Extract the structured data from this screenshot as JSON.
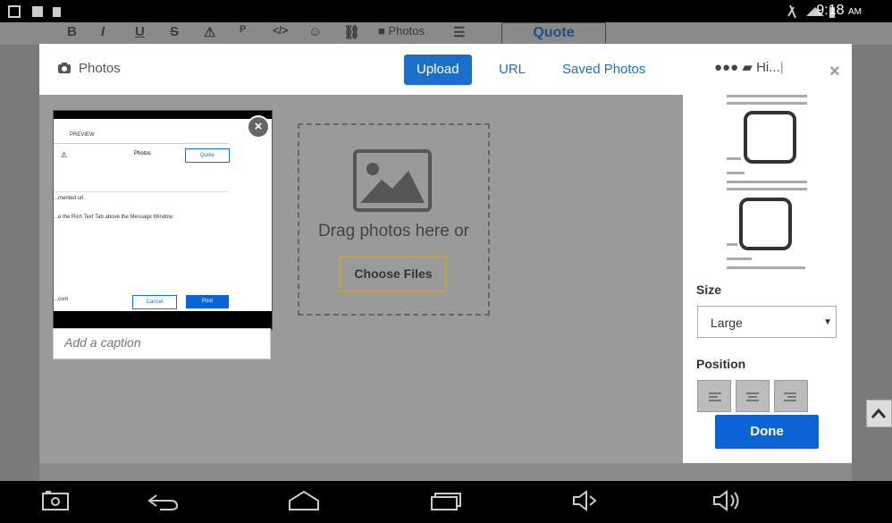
{
  "status_bar": {
    "time": "9:18",
    "ampm": "AM"
  },
  "editor_toolbar": {
    "photos_label": "Photos",
    "quote_tab": "Quote"
  },
  "modal": {
    "title": "Photos",
    "tabs": [
      {
        "label": "Upload",
        "active": true
      },
      {
        "label": "URL",
        "active": false
      },
      {
        "label": "Saved Photos",
        "active": false
      }
    ],
    "breadcrumb": "Hi...",
    "dropzone_text": "Drag photos here or",
    "choose_files_label": "Choose Files",
    "caption_placeholder": "Add a caption",
    "thumbnail": {
      "preview_tab": "PREVIEW",
      "photos_label": "Photos",
      "quote_label": "Quote",
      "text_line1": "...mented url.",
      "text_line2": "...e the Rich Text Tab above the Message Window.",
      "cancel_label": "Cancel",
      "post_label": "Post",
      "footer_text": "...com"
    },
    "panel": {
      "size_label": "Size",
      "size_value": "Large",
      "position_label": "Position",
      "done_label": "Done"
    }
  },
  "colors": {
    "accent": "#1a6fc9",
    "done": "#0c63d6",
    "overlay": "#9a9a9a"
  }
}
